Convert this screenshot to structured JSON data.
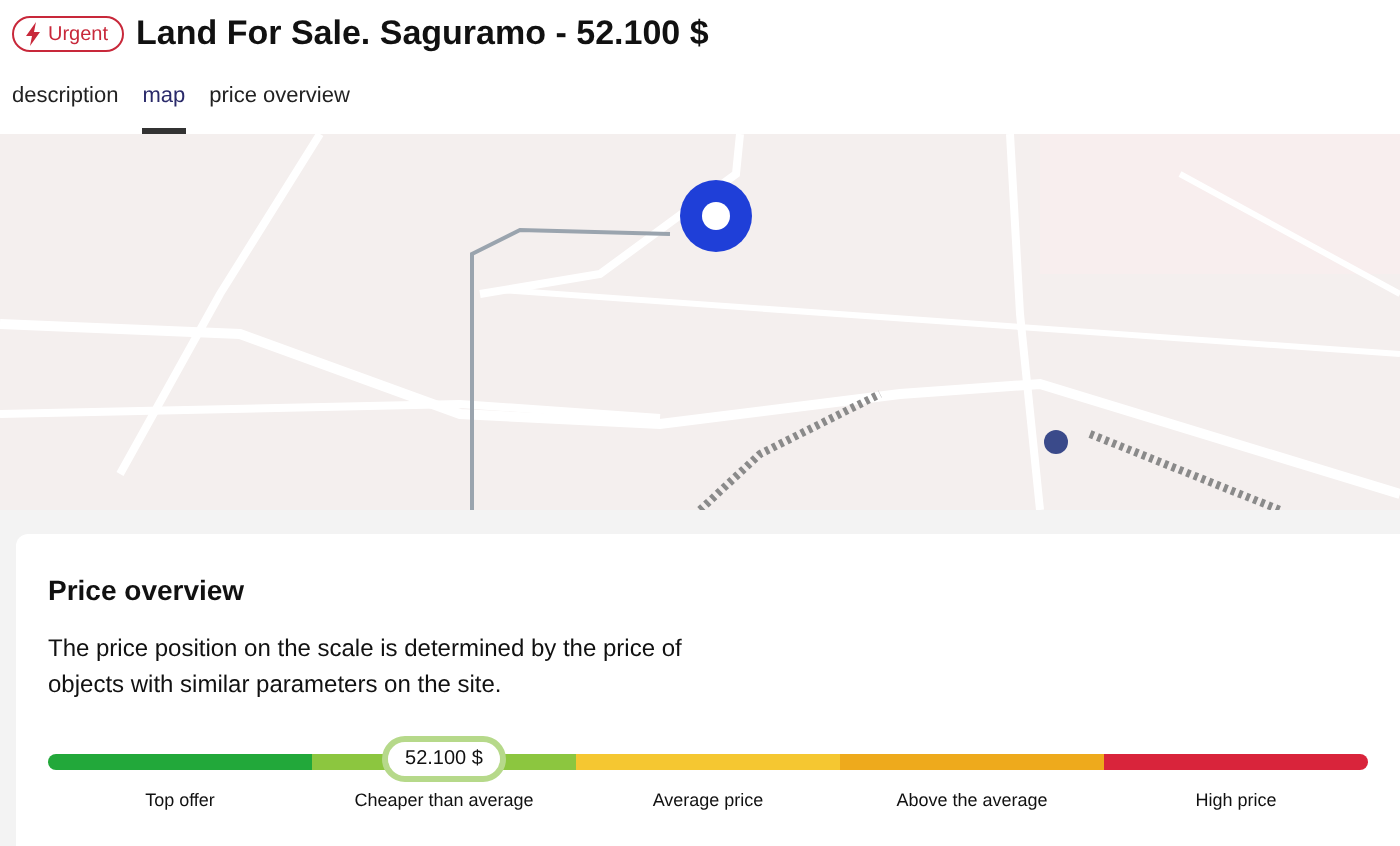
{
  "header": {
    "badge": "Urgent",
    "title": "Land For Sale. Saguramo - 52.100 $"
  },
  "tabs": [
    {
      "label": "description",
      "selected": false
    },
    {
      "label": "map",
      "selected": true
    },
    {
      "label": "price overview",
      "selected": false
    }
  ],
  "price_overview": {
    "title": "Price overview",
    "description": "The price position on the scale is determined by the price of objects with similar parameters on the site.",
    "price_badge": "52.100 $",
    "segments": [
      {
        "label": "Top offer",
        "color": "#22a83a",
        "selected": false
      },
      {
        "label": "Cheaper than average",
        "color": "#8cc63f",
        "selected": true
      },
      {
        "label": "Average price",
        "color": "#f5c731",
        "selected": false
      },
      {
        "label": "Above the average",
        "color": "#eeaa1c",
        "selected": false
      },
      {
        "label": "High price",
        "color": "#d9243b",
        "selected": false
      }
    ]
  }
}
